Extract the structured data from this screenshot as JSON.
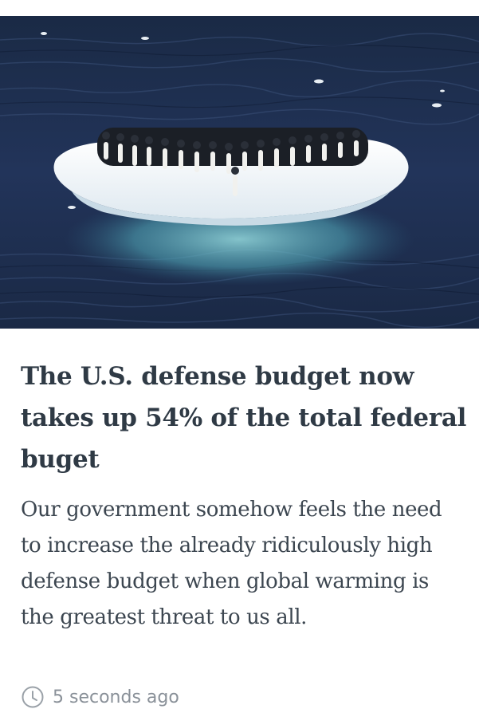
{
  "article": {
    "image_alt": "Penguins on an ice floe in the ocean",
    "headline": "The U.S. defense budget now takes up 54% of the total federal buget",
    "body": "Our government somehow feels the need to increase the already ridiculously high defense budget when global warming is the greatest threat to us all.",
    "timestamp": "5 seconds ago",
    "timestamp_icon": "clock-icon"
  },
  "colors": {
    "headline": "#2f3a45",
    "body": "#3c4650",
    "meta": "#8a9199",
    "ocean": "#1c2c48"
  }
}
